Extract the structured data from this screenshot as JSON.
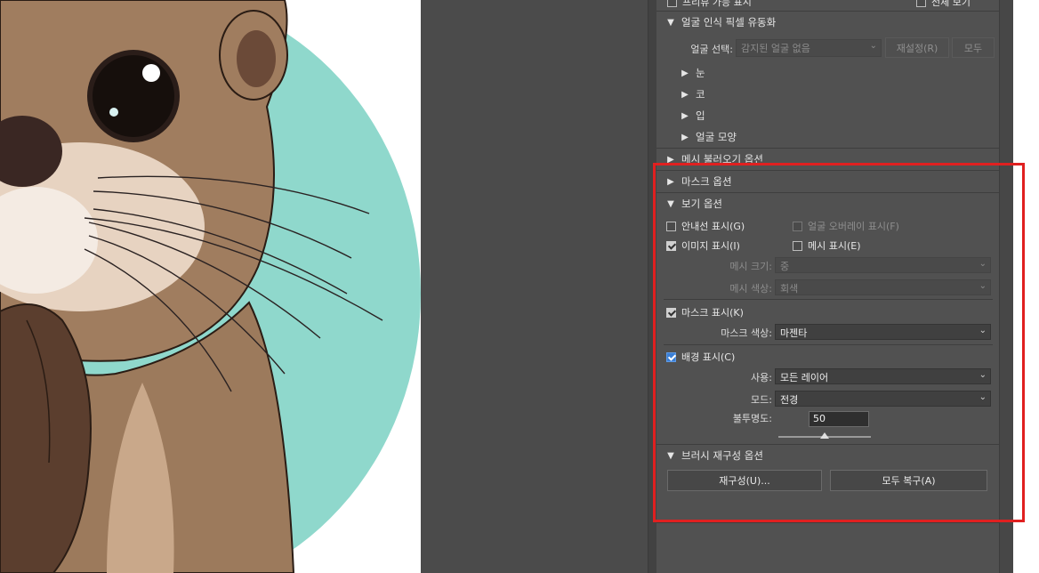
{
  "top_partial": {
    "left_checkbox_label": "프리뷰 가능 표시",
    "right_checkbox_label": "전체 보기"
  },
  "face_aware": {
    "header": "얼굴 인식 픽셀 유동화",
    "face_select_label": "얼굴 선택:",
    "face_select_value": "감지된 얼굴 없음",
    "reset_button": "재설정(R)",
    "all_button": "모두",
    "items": [
      "눈",
      "코",
      "입",
      "얼굴 모양"
    ]
  },
  "mesh_load": {
    "header": "메시 불러오기 옵션"
  },
  "mask_options": {
    "header": "마스크 옵션"
  },
  "view_options": {
    "header": "보기 옵션",
    "show_guides": "안내선 표시(G)",
    "show_face_overlay": "얼굴 오버레이 표시(F)",
    "show_image": "이미지 표시(I)",
    "show_mesh": "메시 표시(E)",
    "mesh_size_label": "메시 크기:",
    "mesh_size_value": "중",
    "mesh_color_label": "메시 색상:",
    "mesh_color_value": "회색",
    "show_mask": "마스크 표시(K)",
    "mask_color_label": "마스크 색상:",
    "mask_color_value": "마젠타",
    "show_backdrop": "배경 표시(C)",
    "use_label": "사용:",
    "use_value": "모든 레이어",
    "mode_label": "모드:",
    "mode_value": "전경",
    "opacity_label": "불투명도:",
    "opacity_value": "50",
    "opacity_fraction": 0.5,
    "checked": {
      "guides": false,
      "face_overlay": false,
      "image": true,
      "mesh": false,
      "mask": true,
      "backdrop": true
    }
  },
  "brush_reconstruct": {
    "header": "브러시 재구성 옵션",
    "reconstruct_button": "재구성(U)...",
    "restore_all_button": "모두 복구(A)"
  },
  "colors": {
    "highlight": "#e02020",
    "checkbox_blue": "#3a7fd6",
    "canvas_circle": "#8fd8cc"
  },
  "icons": [
    "triangle-down-icon",
    "triangle-right-icon",
    "chevron-down-icon"
  ]
}
